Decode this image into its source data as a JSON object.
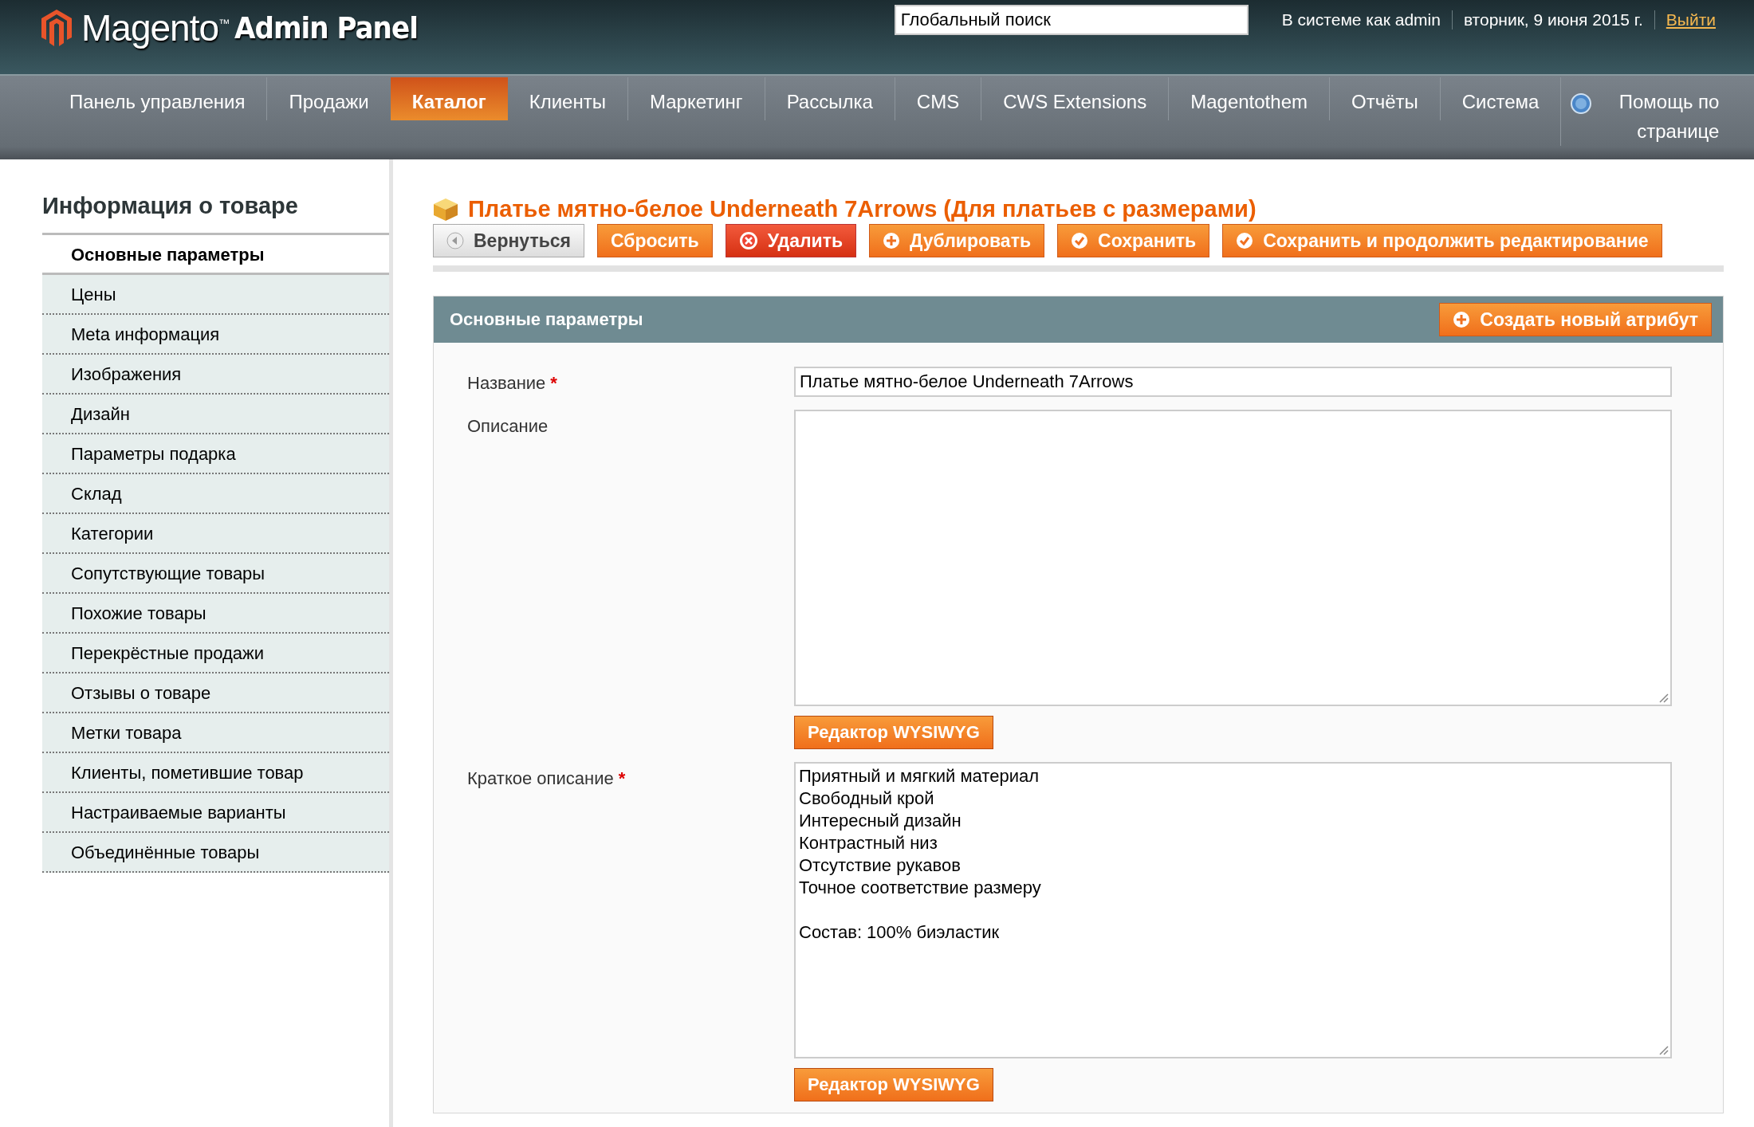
{
  "header": {
    "logo": {
      "brand": "Magento",
      "trademark": "™",
      "product": "Admin Panel"
    },
    "search": {
      "value": "Глобальный поиск"
    },
    "user": "В системе как admin",
    "date": "вторник, 9 июня 2015 г.",
    "logout": "Выйти"
  },
  "nav": [
    {
      "label": "Панель управления",
      "selected": false
    },
    {
      "label": "Продажи",
      "selected": false
    },
    {
      "label": "Каталог",
      "selected": true
    },
    {
      "label": "Клиенты",
      "selected": false
    },
    {
      "label": "Маркетинг",
      "selected": false
    },
    {
      "label": "Рассылка",
      "selected": false
    },
    {
      "label": "CMS",
      "selected": false
    },
    {
      "label": "CWS Extensions",
      "selected": false
    },
    {
      "label": "Magentothem",
      "selected": false
    },
    {
      "label": "Отчёты",
      "selected": false
    },
    {
      "label": "Система",
      "selected": false
    },
    {
      "label": "Помощь по странице",
      "selected": false,
      "kind": "help"
    }
  ],
  "sidebar": {
    "title": "Информация о товаре",
    "items": [
      {
        "label": "Основные параметры",
        "selected": true
      },
      {
        "label": "Цены",
        "selected": false
      },
      {
        "label": "Meta информация",
        "selected": false
      },
      {
        "label": "Изображения",
        "selected": false
      },
      {
        "label": "Дизайн",
        "selected": false
      },
      {
        "label": "Параметры подарка",
        "selected": false
      },
      {
        "label": "Склад",
        "selected": false
      },
      {
        "label": "Категории",
        "selected": false
      },
      {
        "label": "Сопутствующие товары",
        "selected": false
      },
      {
        "label": "Похожие товары",
        "selected": false
      },
      {
        "label": "Перекрёстные продажи",
        "selected": false
      },
      {
        "label": "Отзывы о товаре",
        "selected": false
      },
      {
        "label": "Метки товара",
        "selected": false
      },
      {
        "label": "Клиенты, пометившие товар",
        "selected": false
      },
      {
        "label": "Настраиваемые варианты",
        "selected": false
      },
      {
        "label": "Объединённые товары",
        "selected": false
      }
    ]
  },
  "page_title": "Платье мятно-белое Underneath 7Arrows (Для платьев с размерами)",
  "actions": [
    {
      "label": "Вернуться",
      "kind": "back"
    },
    {
      "label": "Сбросить",
      "kind": "plain"
    },
    {
      "label": "Удалить",
      "kind": "delete"
    },
    {
      "label": "Дублировать",
      "kind": "add"
    },
    {
      "label": "Сохранить",
      "kind": "save"
    },
    {
      "label": "Сохранить и продолжить редактирование",
      "kind": "save"
    }
  ],
  "section": {
    "title": "Основные параметры",
    "create_button": "Создать новый атрибут",
    "fields": [
      {
        "label": "Название",
        "required_mark": "*",
        "kind": "input",
        "value": "Платье мятно-белое Underneath 7Arrows"
      },
      {
        "label": "Описание",
        "kind": "textarea",
        "editor_button": "Редактор WYSIWYG"
      },
      {
        "label": "Краткое описание",
        "required_mark": "*",
        "kind": "textarea",
        "value": "Приятный и мягкий материал\nСвободный крой\nИнтересный дизайн\nКонтрастный низ\nОтсутствие рукавов\nТочное соответствие размеру\n\nСостав: 100% биэластик",
        "editor_button": "Редактор WYSIWYG"
      }
    ]
  }
}
